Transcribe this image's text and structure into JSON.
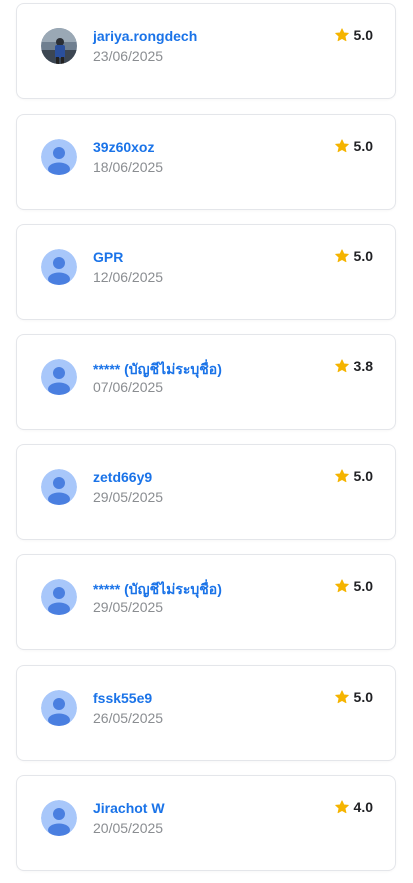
{
  "reviews": [
    {
      "name": "jariya.rongdech",
      "date": "23/06/2025",
      "rating": "5.0",
      "avatar": "photo-avatar"
    },
    {
      "name": "39z60xoz",
      "date": "18/06/2025",
      "rating": "5.0",
      "avatar": "default-user-avatar"
    },
    {
      "name": "GPR",
      "date": "12/06/2025",
      "rating": "5.0",
      "avatar": "default-user-avatar"
    },
    {
      "name": "***** (บัญชีไม่ระบุชื่อ)",
      "date": "07/06/2025",
      "rating": "3.8",
      "avatar": "default-user-avatar"
    },
    {
      "name": "zetd66y9",
      "date": "29/05/2025",
      "rating": "5.0",
      "avatar": "default-user-avatar"
    },
    {
      "name": "***** (บัญชีไม่ระบุชื่อ)",
      "date": "29/05/2025",
      "rating": "5.0",
      "avatar": "default-user-avatar"
    },
    {
      "name": "fssk55e9",
      "date": "26/05/2025",
      "rating": "5.0",
      "avatar": "default-user-avatar"
    },
    {
      "name": "Jirachot W",
      "date": "20/05/2025",
      "rating": "4.0",
      "avatar": "default-user-avatar"
    }
  ],
  "colors": {
    "accent": "#1a73e8",
    "star": "#f5b400",
    "avatar_bg": "#a8c7fa",
    "avatar_fg": "#4a7fe0"
  }
}
